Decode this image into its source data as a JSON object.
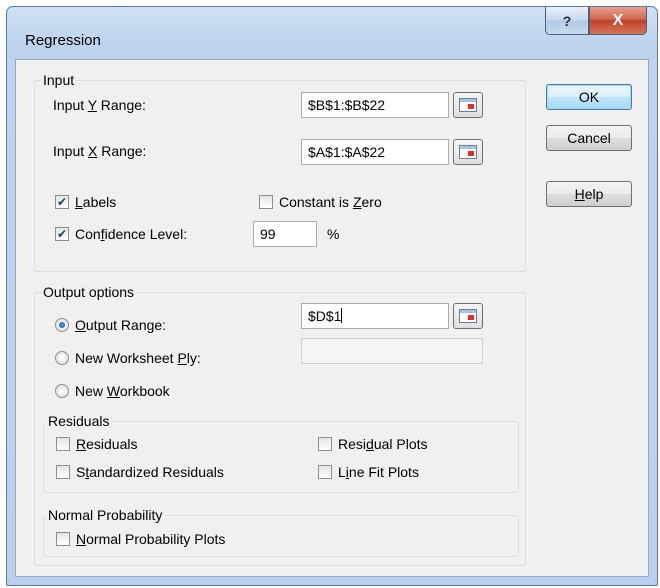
{
  "window": {
    "title": "Regression",
    "help_glyph": "?",
    "close_glyph": "X"
  },
  "input_group": {
    "label": "Input",
    "y_range": {
      "label_pre": "Input ",
      "label_u": "Y",
      "label_post": " Range:",
      "value": "$B$1:$B$22"
    },
    "x_range": {
      "label_pre": "Input ",
      "label_u": "X",
      "label_post": " Range:",
      "value": "$A$1:$A$22"
    },
    "labels": {
      "label_u": "L",
      "label_post": "abels",
      "checked": true
    },
    "constant_zero": {
      "label_pre": "Constant is ",
      "label_u": "Z",
      "label_post": "ero",
      "checked": false
    },
    "confidence": {
      "label_pre": "Con",
      "label_u": "f",
      "label_post": "idence Level:",
      "checked": true,
      "value": "99",
      "unit": "%"
    }
  },
  "output_group": {
    "label": "Output options",
    "output_range": {
      "label_u": "O",
      "label_post": "utput Range:",
      "selected": true,
      "value": "$D$1"
    },
    "new_worksheet": {
      "label_pre": "New Worksheet ",
      "label_u": "P",
      "label_post": "ly:",
      "selected": false,
      "value": ""
    },
    "new_workbook": {
      "label_pre": "New ",
      "label_u": "W",
      "label_post": "orkbook",
      "selected": false
    }
  },
  "residuals_group": {
    "label": "Residuals",
    "residuals": {
      "label_u": "R",
      "label_post": "esiduals",
      "checked": false
    },
    "standardized": {
      "label_pre": "S",
      "label_u": "t",
      "label_post": "andardized Residuals",
      "checked": false
    },
    "residual_plots": {
      "label_pre": "Resi",
      "label_u": "d",
      "label_post": "ual Plots",
      "checked": false
    },
    "line_fit": {
      "label_pre": "L",
      "label_u": "i",
      "label_post": "ne Fit Plots",
      "checked": false
    }
  },
  "normal_group": {
    "label": "Normal Probability",
    "normal_plots": {
      "label_u": "N",
      "label_post": "ormal Probability Plots",
      "checked": false
    }
  },
  "buttons": {
    "ok": "OK",
    "cancel": "Cancel",
    "help_u": "H",
    "help_post": "elp"
  },
  "icons": {
    "range_selector": "collapse-dialog-icon"
  }
}
